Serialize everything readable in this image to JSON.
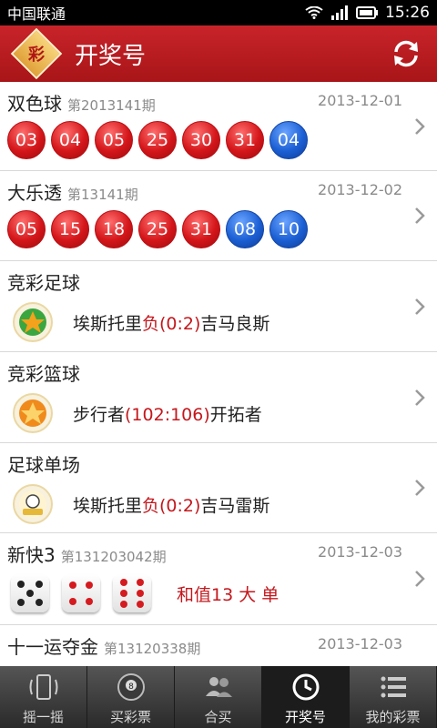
{
  "status_bar": {
    "carrier": "中国联通",
    "time": "15:26"
  },
  "header": {
    "logo_text": "彩",
    "title": "开奖号"
  },
  "lotteries": [
    {
      "name": "双色球",
      "issue": "第2013141期",
      "date": "2013-12-01",
      "red": [
        "03",
        "04",
        "05",
        "25",
        "30",
        "31"
      ],
      "blue": [
        "04"
      ]
    },
    {
      "name": "大乐透",
      "issue": "第13141期",
      "date": "2013-12-02",
      "red": [
        "05",
        "15",
        "18",
        "25",
        "31"
      ],
      "blue": [
        "08",
        "10"
      ]
    }
  ],
  "matches": [
    {
      "name": "竞彩足球",
      "home": "埃斯托里",
      "score": "负(0:2)",
      "away": "吉马良斯"
    },
    {
      "name": "竞彩篮球",
      "home": "步行者",
      "score": "(102:106)",
      "away": "开拓者"
    },
    {
      "name": "足球单场",
      "home": "埃斯托里",
      "score": "负(0:2)",
      "away": "吉马雷斯"
    }
  ],
  "kuai3": {
    "name": "新快3",
    "issue": "第131203042期",
    "date": "2013-12-03",
    "dice": [
      5,
      4,
      6
    ],
    "result": "和值13 大 单"
  },
  "syxw": {
    "name": "十一运夺金",
    "issue": "第13120338期",
    "date": "2013-12-03"
  },
  "tabs": [
    {
      "label": "摇一摇",
      "icon": "shake-phone-icon"
    },
    {
      "label": "买彩票",
      "icon": "billiard-ball-icon"
    },
    {
      "label": "合买",
      "icon": "group-users-icon"
    },
    {
      "label": "开奖号",
      "icon": "clock-icon",
      "active": true
    },
    {
      "label": "我的彩票",
      "icon": "list-menu-icon"
    }
  ],
  "colors": {
    "header_red": "#c8242a",
    "ball_red": "#d4161a",
    "ball_blue": "#1b5fd4",
    "score_red": "#c4171c"
  }
}
